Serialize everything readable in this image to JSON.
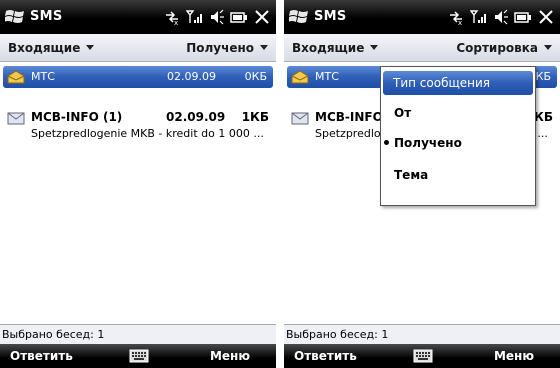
{
  "left": {
    "title": "SMS",
    "header": {
      "left": "Входящие",
      "right": "Получено"
    },
    "rows": [
      {
        "name": "МТС",
        "date": "02.09.09",
        "size": "0КБ"
      },
      {
        "name": "MCB-INFO (1)",
        "date": "02.09.09",
        "size": "1КБ",
        "preview": "Spetzpredlogenie MKB - kredit do 1 000 ..."
      }
    ],
    "status": "Выбрано бесед: 1",
    "softkeys": {
      "left": "Ответить",
      "right": "Меню"
    }
  },
  "right": {
    "title": "SMS",
    "header": {
      "left": "Входящие",
      "right": "Сортировка"
    },
    "rows": [
      {
        "name": "МТС",
        "date": "",
        "size": "0КБ"
      },
      {
        "name": "MCB-INFO (1)",
        "date": "",
        "size": "1КБ",
        "preview": "Spetzpredlogenie MKB - kredit do 1 000 ..."
      }
    ],
    "menu": {
      "items": [
        "Тип сообщения",
        "От",
        "Получено",
        "Тема"
      ]
    },
    "status": "Выбрано бесед: 1",
    "softkeys": {
      "left": "Ответить",
      "right": "Меню"
    }
  },
  "icons": [
    "windows-flag-icon",
    "connectivity-icon",
    "signal-icon",
    "volume-icon",
    "battery-icon",
    "close-icon",
    "envelope-open-icon",
    "envelope-icon",
    "keyboard-icon"
  ],
  "colors": {
    "selection": "#2f5fb7",
    "titlebar": "#000000",
    "header": "#d9dbe6"
  }
}
